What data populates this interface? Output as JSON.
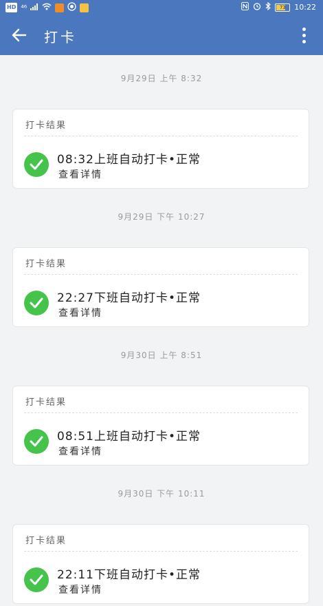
{
  "status_bar": {
    "left_badges": [
      "HD",
      "⁴⁶"
    ],
    "battery_level": "73",
    "time": "10:22",
    "accent_colors": {
      "bar": "#4a77be",
      "orange": "#f28c28",
      "yellow": "#f5c242"
    }
  },
  "app_bar": {
    "title": "打卡",
    "back_icon": "arrow-left-icon",
    "more_icon": "more-vertical-icon"
  },
  "records": [
    {
      "timestamp": "9月29日  上午 8:32",
      "card_title": "打卡结果",
      "time": "08:32",
      "description": "上班自动打卡•正常",
      "detail_link": "查看详情"
    },
    {
      "timestamp": "9月29日  下午 10:27",
      "card_title": "打卡结果",
      "time": "22:27",
      "description": "下班自动打卡•正常",
      "detail_link": "查看详情"
    },
    {
      "timestamp": "9月30日  上午 8:51",
      "card_title": "打卡结果",
      "time": "08:51",
      "description": "上班自动打卡•正常",
      "detail_link": "查看详情"
    },
    {
      "timestamp": "9月30日  下午 10:11",
      "card_title": "打卡结果",
      "time": "22:11",
      "description": "下班自动打卡•正常",
      "detail_link": "查看详情"
    }
  ],
  "colors": {
    "success": "#46c34b",
    "background": "#f2f3f5"
  }
}
